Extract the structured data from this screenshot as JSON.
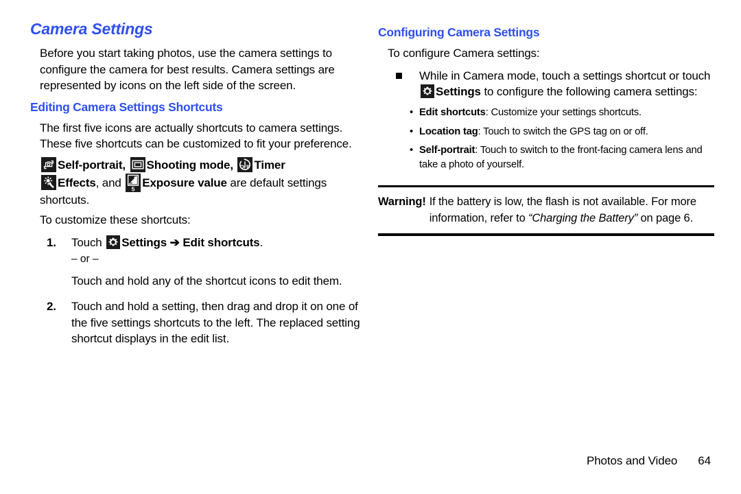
{
  "document": {
    "left_column": {
      "title": "Camera Settings",
      "intro": "Before you start taking photos, use the camera settings to configure the camera for best results. Camera settings are represented by icons on the left side of the screen.",
      "subheading": "Editing Camera Settings Shortcuts",
      "paragraph_1": "The first five icons are actually shortcuts to camera settings. These five shortcuts can be customized to fit your preference.",
      "defaults_line": {
        "icon_1": "self-portrait-icon",
        "label_1": "Self-portrait",
        "sep_1": ", ",
        "icon_2": "shooting-mode-icon",
        "label_2": "Shooting mode",
        "sep_2": ", ",
        "icon_3": "timer-icon",
        "label_3": "Timer",
        "icon_4": "effects-icon",
        "label_4": "Effects",
        "sep_4": ", and ",
        "icon_5": "exposure-value-icon",
        "label_5": "Exposure value",
        "tail": " are default settings shortcuts."
      },
      "customize_lead": "To customize these shortcuts:",
      "steps": [
        {
          "number": "1.",
          "pre": "Touch ",
          "icon": "settings-gear-icon",
          "bold_1": "Settings",
          "arrow": "➔",
          "bold_2": "Edit shortcuts",
          "post": ".",
          "or": "– or –",
          "alt": "Touch and hold any of the shortcut icons to edit them."
        },
        {
          "number": "2.",
          "text": "Touch and hold a setting, then drag and drop it on one of the five settings shortcuts to the left. The replaced setting shortcut displays in the edit list."
        }
      ]
    },
    "right_column": {
      "subheading": "Configuring Camera Settings",
      "lead": "To configure Camera settings:",
      "bullet": {
        "pre": "While in Camera mode, touch a settings shortcut or touch ",
        "icon": "settings-gear-icon",
        "bold": "Settings",
        "post": " to configure the following camera settings:"
      },
      "sub_bullets": [
        {
          "marker": "•",
          "term": "Edit shortcuts",
          "sep": ": ",
          "desc": "Customize your settings shortcuts."
        },
        {
          "marker": "•",
          "term": "Location tag",
          "sep": ": ",
          "desc": "Touch to switch the GPS tag on or off."
        },
        {
          "marker": "•",
          "term": "Self-portrait",
          "sep": ": ",
          "desc": "Touch to switch to the front-facing camera lens and take a photo of yourself."
        }
      ],
      "warning": {
        "label": "Warning!",
        "text_1": "If the battery is low, the flash is not available. For more information, refer to ",
        "reference": "“Charging the Battery”",
        "text_2": " on page 6."
      }
    },
    "footer": {
      "section": "Photos and Video",
      "page_number": "64"
    },
    "colors": {
      "heading_blue": "#2f4ff0",
      "body_black": "#000000",
      "icon_background": "#1b1b1b",
      "page_background": "#ffffff"
    }
  }
}
